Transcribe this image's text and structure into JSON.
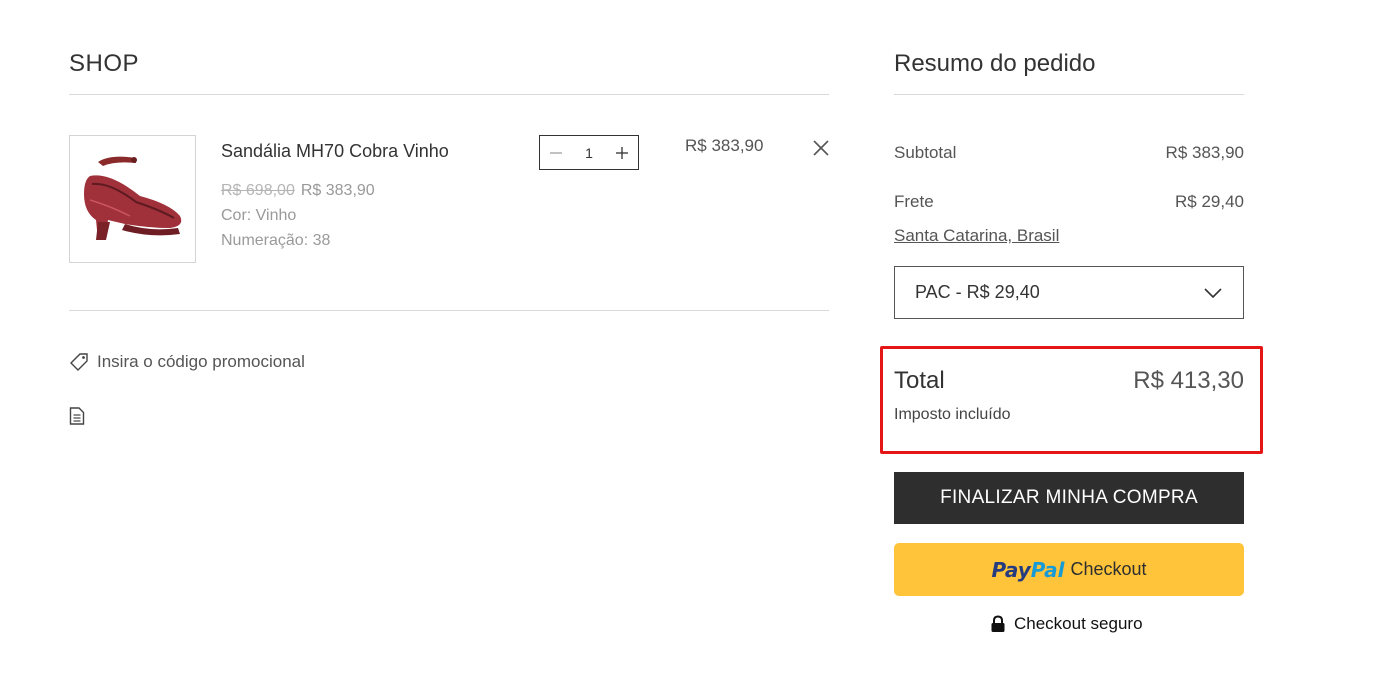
{
  "cart": {
    "title": "SHOP",
    "item": {
      "name": "Sandália MH70 Cobra Vinho",
      "price_original": "R$ 698,00",
      "price_sale": "R$ 383,90",
      "color": "Cor: Vinho",
      "size": "Numeração: 38",
      "quantity": "1",
      "line_total": "R$ 383,90",
      "image_icon": "sandal-product-image"
    },
    "promo_label": "Insira o código promocional",
    "icons": {
      "promo": "tag-icon",
      "note": "note-icon",
      "remove": "close-icon",
      "minus": "minus-icon",
      "plus": "plus-icon"
    }
  },
  "summary": {
    "title": "Resumo do pedido",
    "subtotal_label": "Subtotal",
    "subtotal_value": "R$ 383,90",
    "shipping_label": "Frete",
    "shipping_value": "R$ 29,40",
    "location": "Santa Catarina, Brasil",
    "shipping_option": "PAC - R$ 29,40",
    "total_label": "Total",
    "total_value": "R$ 413,30",
    "tax_note": "Imposto incluído",
    "checkout_label": "FINALIZAR MINHA COMPRA",
    "paypal": {
      "brand_pay": "Pay",
      "brand_pal": "Pal",
      "label": "Checkout"
    },
    "secure_label": "Checkout seguro"
  },
  "colors": {
    "highlight_border": "#e51616",
    "checkout_bg": "#2e2e2e",
    "paypal_bg": "#ffc439",
    "paypal_blue_dark": "#253b80",
    "paypal_blue_light": "#179bd7"
  }
}
